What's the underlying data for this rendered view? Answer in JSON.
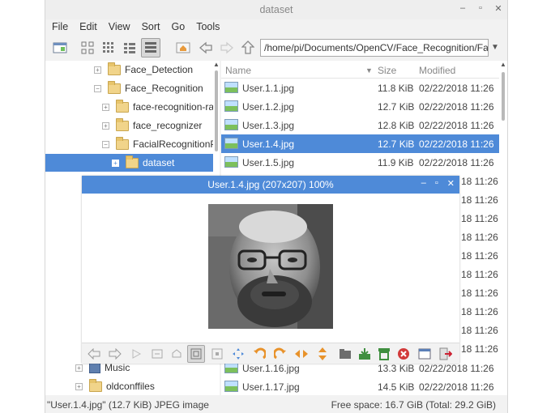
{
  "window": {
    "title": "dataset"
  },
  "menu": [
    "File",
    "Edit",
    "View",
    "Sort",
    "Go",
    "Tools"
  ],
  "toolbar": {
    "path": "/home/pi/Documents/OpenCV/Face_Recognition/Fa"
  },
  "tree": {
    "items": [
      {
        "label": "Face_Detection",
        "expander": "+"
      },
      {
        "label": "Face_Recognition",
        "expander": "−"
      },
      {
        "label": "face-recognition-rar",
        "expander": "+"
      },
      {
        "label": "face_recognizer",
        "expander": "+"
      },
      {
        "label": "FacialRecognitionP",
        "expander": "−"
      },
      {
        "label": "dataset",
        "expander": "+"
      },
      {
        "label": "Music",
        "expander": "+"
      },
      {
        "label": "oldconffiles",
        "expander": "+"
      }
    ]
  },
  "list": {
    "columns": {
      "name": "Name",
      "size": "Size",
      "modified": "Modified"
    },
    "rows": [
      {
        "name": "User.1.1.jpg",
        "size": "11.8 KiB",
        "modified": "02/22/2018 11:26"
      },
      {
        "name": "User.1.2.jpg",
        "size": "12.7 KiB",
        "modified": "02/22/2018 11:26"
      },
      {
        "name": "User.1.3.jpg",
        "size": "12.8 KiB",
        "modified": "02/22/2018 11:26"
      },
      {
        "name": "User.1.4.jpg",
        "size": "12.7 KiB",
        "modified": "02/22/2018 11:26"
      },
      {
        "name": "User.1.5.jpg",
        "size": "11.9 KiB",
        "modified": "02/22/2018 11:26"
      }
    ],
    "hidden_time": "18 11:26",
    "bottom_rows": [
      {
        "name": "User.1.16.jpg",
        "size": "13.3 KiB",
        "modified": "02/22/2018 11:26"
      },
      {
        "name": "User.1.17.jpg",
        "size": "14.5 KiB",
        "modified": "02/22/2018 11:26"
      }
    ]
  },
  "status": {
    "selection": "\"User.1.4.jpg\" (12.7 KiB) JPEG image",
    "free_space": "Free space: 16.7 GiB (Total: 29.2 GiB)"
  },
  "viewer": {
    "title": "User.1.4.jpg (207x207) 100%"
  },
  "colors": {
    "selection": "#4e8ad8",
    "folder": "#f1d48a"
  }
}
